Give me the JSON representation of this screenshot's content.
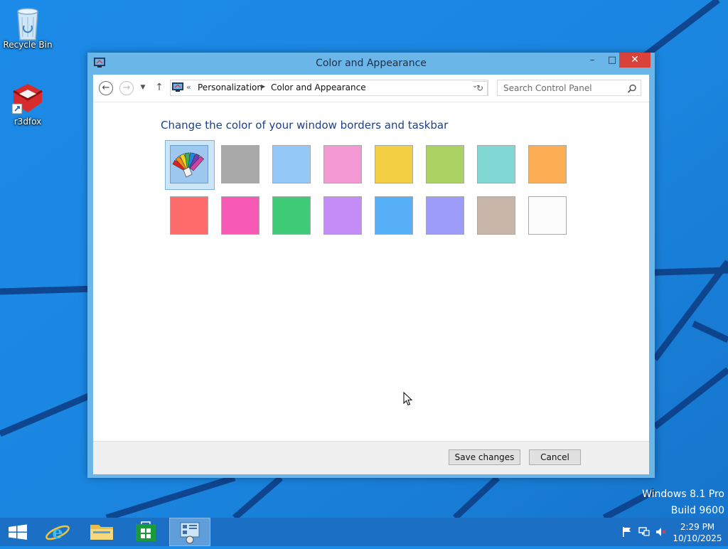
{
  "desktop": {
    "icons": [
      {
        "label": "Recycle Bin",
        "icon": "recycle-bin-icon"
      },
      {
        "label": "r3dfox",
        "icon": "r3dfox-icon"
      }
    ],
    "watermark_line1": "Windows 8.1 Pro",
    "watermark_line2": "Build 9600"
  },
  "window": {
    "title": "Color and Appearance",
    "controls": {
      "minimize": "–",
      "maximize": "□",
      "close": "✕"
    }
  },
  "navigation": {
    "back_icon": "back-arrow-icon",
    "forward_icon": "forward-arrow-icon",
    "up_icon": "up-arrow-icon",
    "overflow": "«",
    "breadcrumbs": [
      "Personalization",
      "Color and Appearance"
    ],
    "search_placeholder": "Search Control Panel"
  },
  "content": {
    "heading": "Change the color of your window borders and taskbar",
    "selected_index": 0,
    "swatches": [
      {
        "color": "#9cc8f0",
        "icon": "color-palette-icon"
      },
      {
        "color": "#a9a9a9"
      },
      {
        "color": "#94c8f6"
      },
      {
        "color": "#f39ad5"
      },
      {
        "color": "#f2cf43"
      },
      {
        "color": "#abd363"
      },
      {
        "color": "#7fd8d3"
      },
      {
        "color": "#fcae55"
      },
      {
        "color": "#fe6d6c"
      },
      {
        "color": "#f65ab4"
      },
      {
        "color": "#3fcb77"
      },
      {
        "color": "#c48cf6"
      },
      {
        "color": "#56aff7"
      },
      {
        "color": "#9c9cf8"
      },
      {
        "color": "#c8b6a8"
      },
      {
        "color": "#fcfcfc"
      }
    ]
  },
  "footer": {
    "save_label": "Save changes",
    "cancel_label": "Cancel"
  },
  "taskbar": {
    "items": [
      "start-button",
      "internet-explorer",
      "file-explorer",
      "windows-store",
      "control-panel"
    ],
    "tray_icons": [
      "action-center-flag-icon",
      "network-icon",
      "volume-muted-icon"
    ],
    "time": "2:29 PM",
    "date": "10/10/2025"
  }
}
